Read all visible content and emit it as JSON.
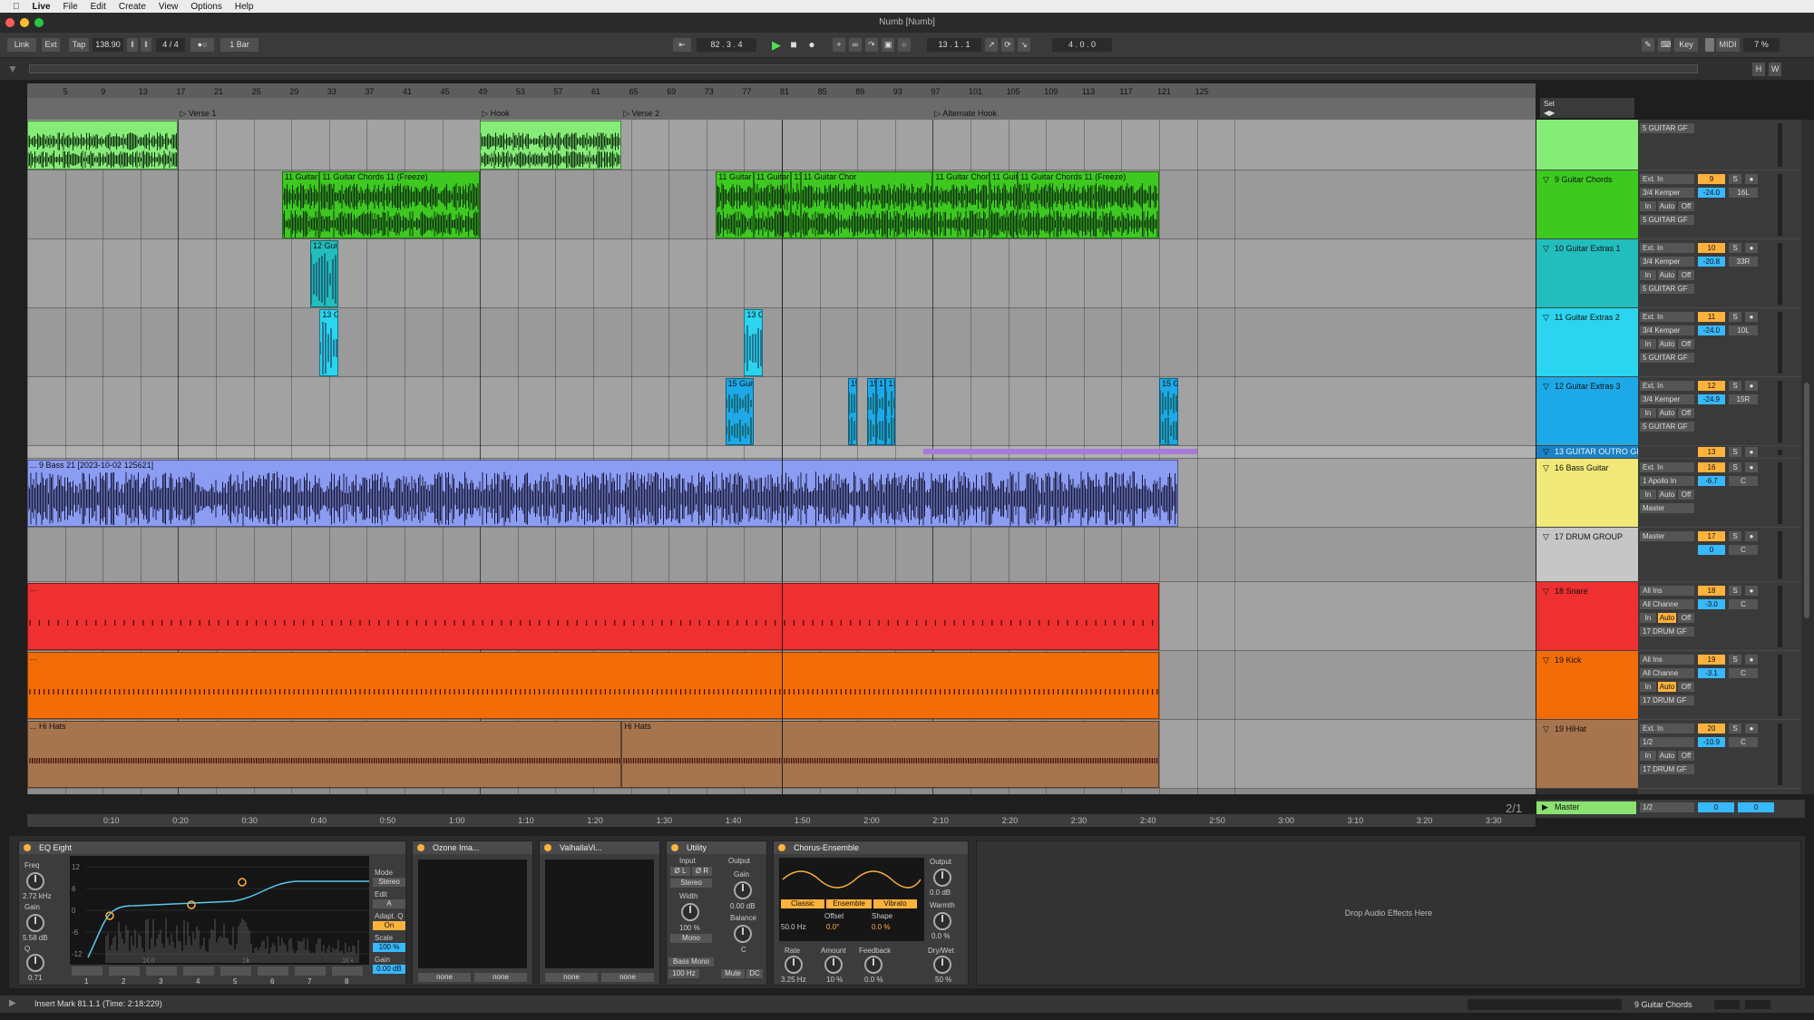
{
  "os_menu": {
    "items": [
      "Live",
      "File",
      "Edit",
      "Create",
      "View",
      "Options",
      "Help"
    ]
  },
  "window": {
    "title": "Numb  [Numb]"
  },
  "transport": {
    "link": "Link",
    "ext": "Ext",
    "tap": "Tap",
    "tempo": "138.90",
    "meter": "4 / 4",
    "quantize": "1 Bar",
    "arr_pos": "82 .   3 .   4",
    "punch_pos": "13 .   1 .   1",
    "loop_len": "4 .   0 .   0",
    "key": "Key",
    "midi": "MIDI",
    "cpu": "7 %"
  },
  "ruler": {
    "bars": [
      "5",
      "9",
      "13",
      "17",
      "21",
      "25",
      "29",
      "33",
      "37",
      "41",
      "45",
      "49",
      "53",
      "57",
      "61",
      "65",
      "69",
      "73",
      "77",
      "81",
      "85",
      "89",
      "93",
      "97",
      "101",
      "105",
      "109",
      "113",
      "117",
      "121",
      "125"
    ]
  },
  "locators": [
    {
      "name": "Verse 1"
    },
    {
      "name": "Hook"
    },
    {
      "name": "Verse 2"
    },
    {
      "name": "Alternate Hook"
    }
  ],
  "set_label": "Set",
  "tracks": [
    {
      "name": "",
      "number": "",
      "color": "#86ec78",
      "input": "",
      "in_sub": "",
      "output": "5 GUITAR GF",
      "vol": "",
      "pan": ""
    },
    {
      "name": "9 Guitar Chords",
      "number": "9",
      "color": "#3dc920",
      "input": "Ext. In",
      "in_sub": "3/4 Kemper",
      "output": "5 GUITAR GF",
      "vol": "-24.0",
      "pan": "16L"
    },
    {
      "name": "10 Guitar Extras 1",
      "number": "10",
      "color": "#22bdbd",
      "input": "Ext. In",
      "in_sub": "3/4 Kemper",
      "output": "5 GUITAR GF",
      "vol": "-20.8",
      "pan": "33R"
    },
    {
      "name": "11 Guitar Extras 2",
      "number": "11",
      "color": "#2bd4ef",
      "input": "Ext. In",
      "in_sub": "3/4 Kemper",
      "output": "5 GUITAR GF",
      "vol": "-24.0",
      "pan": "10L"
    },
    {
      "name": "12 Guitar Extras 3",
      "number": "12",
      "color": "#1da9e7",
      "input": "Ext. In",
      "in_sub": "3/4 Kemper",
      "output": "5 GUITAR GF",
      "vol": "-24.9",
      "pan": "15R"
    },
    {
      "name": "13 GUITAR OUTRO GR",
      "number": "13",
      "color": "#1b82c4"
    },
    {
      "name": "16 Bass Guitar",
      "number": "16",
      "color": "#f0e878",
      "input": "Ext. In",
      "in_sub": "1 Apollo In",
      "output": "Master",
      "vol": "-6.7",
      "pan": "C"
    },
    {
      "name": "17 DRUM GROUP",
      "number": "17",
      "color": "#c6c6c6",
      "output": "Master",
      "vol": "0",
      "pan": "C"
    },
    {
      "name": "18 Snare",
      "number": "18",
      "color": "#ee3030",
      "input": "All Ins",
      "in_sub": "All Channe",
      "output": "17 DRUM GF",
      "vol": "-3.0",
      "pan": "C"
    },
    {
      "name": "19 Kick",
      "number": "19",
      "color": "#f26d08",
      "input": "All Ins",
      "in_sub": "All Channe",
      "output": "17 DRUM GF",
      "vol": "-3.1",
      "pan": "C"
    },
    {
      "name": "19 HiHat",
      "number": "20",
      "color": "#a6744d",
      "input": "Ext. In",
      "in_sub": "1/2",
      "output": "17 DRUM GF",
      "vol": "-10.9",
      "pan": "C"
    }
  ],
  "track_buttons": {
    "in": "In",
    "auto": "Auto",
    "off": "Off",
    "solo": "S"
  },
  "clips": {
    "guitar_chords": [
      "11 Guitar",
      "11 Guitar Chords 11 (Freeze)",
      "11 Guitar",
      "11 Guitar Chords 11 (Freeze)",
      "11",
      "11 Guitar Chor",
      "11 Guitar Chords 11 (Freeze)",
      "11 Guita",
      "11 Guitar Chords 11 (Freeze)"
    ],
    "extras1": "12 Guita",
    "extras2": [
      "13 Gu",
      "13 Gu"
    ],
    "extras3": [
      "15 Guita",
      "15",
      "15",
      "1",
      "1:",
      "15 Gu"
    ],
    "bass": "... 9 Bass 21 [2023-10-02 125621]",
    "hihats": [
      "... Hi Hats",
      "Hi Hats"
    ],
    "snare_label": "...",
    "kick_label": "..."
  },
  "zoom_ratio": "2/1",
  "master": {
    "name": "Master",
    "output": "1/2",
    "vol": "0",
    "pan": "0"
  },
  "time_ruler": [
    "0:10",
    "0:20",
    "0:30",
    "0:40",
    "0:50",
    "1:00",
    "1:10",
    "1:20",
    "1:30",
    "1:40",
    "1:50",
    "2:00",
    "2:10",
    "2:20",
    "2:30",
    "2:40",
    "2:50",
    "3:00",
    "3:10",
    "3:20",
    "3:30"
  ],
  "eq": {
    "title": "EQ Eight",
    "freq_label": "Freq",
    "freq": "2.72 kHz",
    "gain_label": "Gain",
    "gain": "5.58 dB",
    "q_label": "Q",
    "q": "0.71",
    "mode_label": "Mode",
    "mode": "Stereo",
    "edit_label": "Edit",
    "edit": "A",
    "adapt_label": "Adapt. Q",
    "adapt": "On",
    "scale_label": "Scale",
    "scale": "100 %",
    "gain2_label": "Gain",
    "gain2": "0.00 dB",
    "yticks": [
      "12",
      "6",
      "0",
      "-6",
      "-12"
    ],
    "xticks": [
      "100",
      "1k",
      "10k"
    ],
    "bands": [
      "1",
      "2",
      "3",
      "4",
      "5",
      "6",
      "7",
      "8"
    ]
  },
  "ozone": {
    "title": "Ozone Ima...",
    "sel1": "none",
    "sel2": "none"
  },
  "valhalla": {
    "title": "ValhallaVi...",
    "sel1": "none",
    "sel2": "none"
  },
  "utility": {
    "title": "Utility",
    "input_label": "Input",
    "l": "Ø L",
    "r": "Ø R",
    "chmode": "Stereo",
    "width_label": "Width",
    "width": "100 %",
    "mono": "Mono",
    "bassmono": "Bass Mono",
    "bassfreq": "100 Hz",
    "output_label": "Output",
    "gain_label": "Gain",
    "gain": "0.00 dB",
    "balance_label": "Balance",
    "balance": "C",
    "mute": "Mute",
    "dc": "DC"
  },
  "chorus": {
    "title": "Chorus-Ensemble",
    "modes": [
      "Classic",
      "Ensemble",
      "Vibrato"
    ],
    "freq": "50.0 Hz",
    "offset_label": "Offset",
    "offset": "0.0°",
    "shape_label": "Shape",
    "shape": "0.0 %",
    "rate_label": "Rate",
    "rate": "3.25 Hz",
    "amount_label": "Amount",
    "amount": "10 %",
    "feedback_label": "Feedback",
    "feedback": "0.0 %",
    "output_label": "Output",
    "output": "0.0 dB",
    "warmth_label": "Warmth",
    "warmth": "0.0 %",
    "drywet_label": "Dry/Wet",
    "drywet": "50 %"
  },
  "drop_hint": "Drop Audio Effects Here",
  "status": {
    "text": "Insert Mark 81.1.1 (Time: 2:18:229)",
    "selected_track": "9 Guitar Chords"
  }
}
